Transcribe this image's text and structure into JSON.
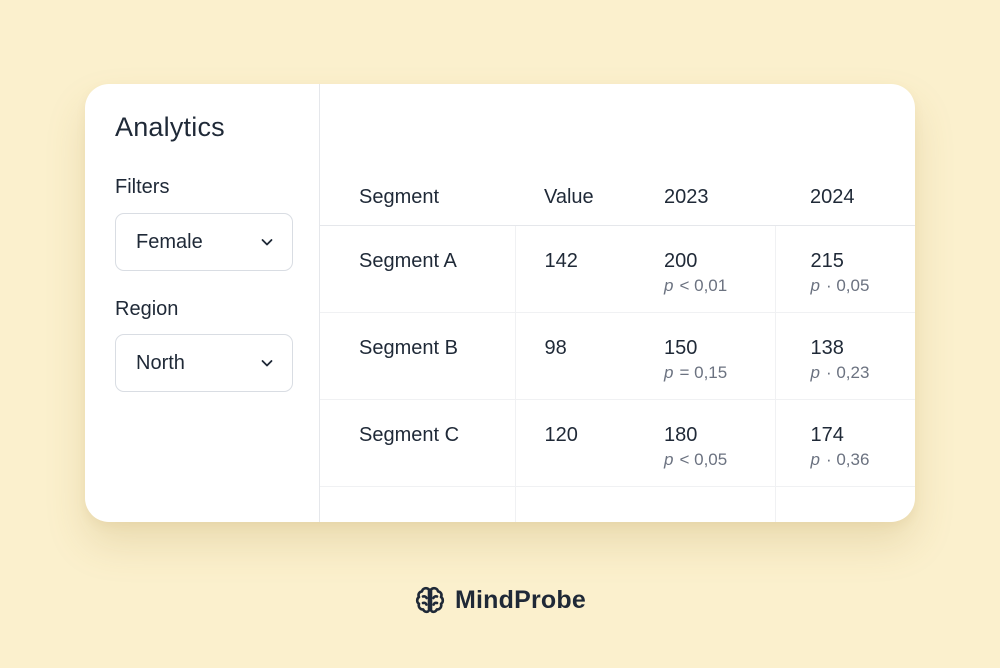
{
  "sidebar": {
    "title": "Analytics",
    "filters_label": "Filters",
    "filter_value": "Female",
    "region_label": "Region",
    "region_value": "North"
  },
  "table": {
    "headers": [
      "Segment",
      "Value",
      "2023",
      "2024"
    ],
    "rows": [
      {
        "segment": "Segment A",
        "value": "142",
        "y2023": "200",
        "p2023_sym": "p",
        "p2023": "< 0,01",
        "y2024": "215",
        "p2024_sym": "p",
        "p2024": "· 0,05"
      },
      {
        "segment": "Segment B",
        "value": "98",
        "y2023": "150",
        "p2023_sym": "p",
        "p2023": "= 0,15",
        "y2024": "138",
        "p2024_sym": "p",
        "p2024": "· 0,23"
      },
      {
        "segment": "Segment C",
        "value": "120",
        "y2023": "180",
        "p2023_sym": "p",
        "p2023": "< 0,05",
        "y2024": "174",
        "p2024_sym": "p",
        "p2024": "· 0,36"
      }
    ]
  },
  "brand": {
    "name": "MindProbe",
    "icon": "brain-icon"
  },
  "colors": {
    "background": "#fbf0cd",
    "text": "#1f2937",
    "muted": "#6b7280"
  }
}
